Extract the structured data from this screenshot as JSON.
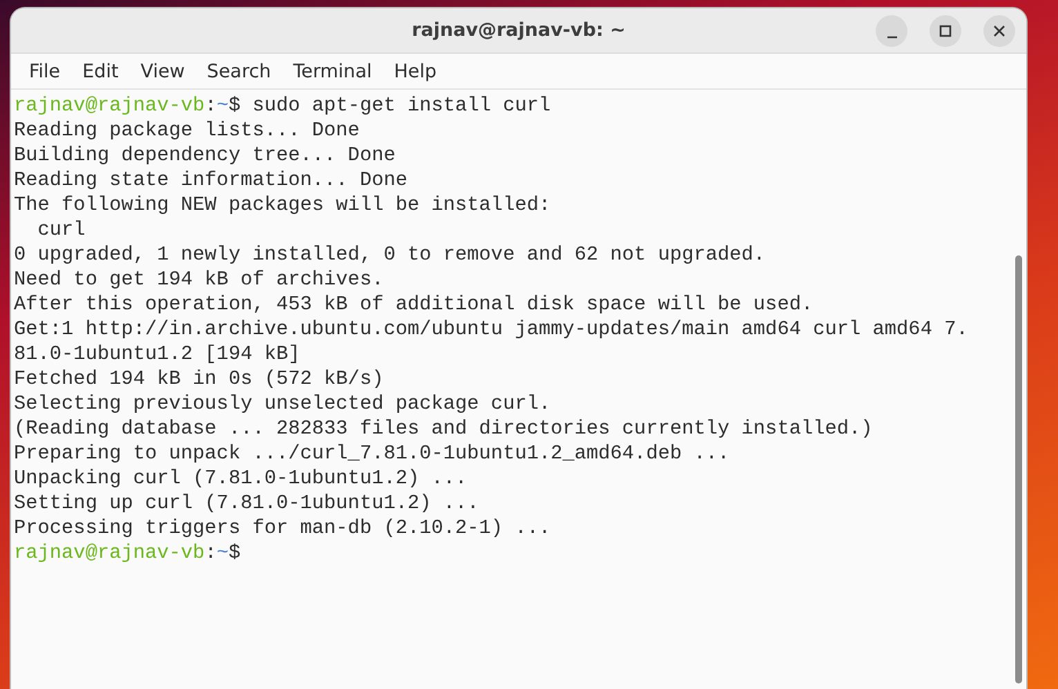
{
  "window": {
    "title": "rajnav@rajnav-vb: ~"
  },
  "menu": [
    "File",
    "Edit",
    "View",
    "Search",
    "Terminal",
    "Help"
  ],
  "terminal": {
    "lines": [
      {
        "kind": "prompt",
        "user": "rajnav@rajnav-vb",
        "separator": ":",
        "path": "~",
        "symbol": "$",
        "command": "sudo apt-get install curl"
      },
      {
        "kind": "output",
        "text": "Reading package lists... Done"
      },
      {
        "kind": "output",
        "text": "Building dependency tree... Done"
      },
      {
        "kind": "output",
        "text": "Reading state information... Done"
      },
      {
        "kind": "output",
        "text": "The following NEW packages will be installed:"
      },
      {
        "kind": "output",
        "text": "  curl"
      },
      {
        "kind": "output",
        "text": "0 upgraded, 1 newly installed, 0 to remove and 62 not upgraded."
      },
      {
        "kind": "output",
        "text": "Need to get 194 kB of archives."
      },
      {
        "kind": "output",
        "text": "After this operation, 453 kB of additional disk space will be used."
      },
      {
        "kind": "output",
        "text": "Get:1 http://in.archive.ubuntu.com/ubuntu jammy-updates/main amd64 curl amd64 7."
      },
      {
        "kind": "output",
        "text": "81.0-1ubuntu1.2 [194 kB]"
      },
      {
        "kind": "output",
        "text": "Fetched 194 kB in 0s (572 kB/s)"
      },
      {
        "kind": "output",
        "text": "Selecting previously unselected package curl."
      },
      {
        "kind": "output",
        "text": "(Reading database ... 282833 files and directories currently installed.)"
      },
      {
        "kind": "output",
        "text": "Preparing to unpack .../curl_7.81.0-1ubuntu1.2_amd64.deb ..."
      },
      {
        "kind": "output",
        "text": "Unpacking curl (7.81.0-1ubuntu1.2) ..."
      },
      {
        "kind": "output",
        "text": "Setting up curl (7.81.0-1ubuntu1.2) ..."
      },
      {
        "kind": "output",
        "text": "Processing triggers for man-db (2.10.2-1) ..."
      },
      {
        "kind": "prompt",
        "user": "rajnav@rajnav-vb",
        "separator": ":",
        "path": "~",
        "symbol": "$"
      }
    ]
  }
}
